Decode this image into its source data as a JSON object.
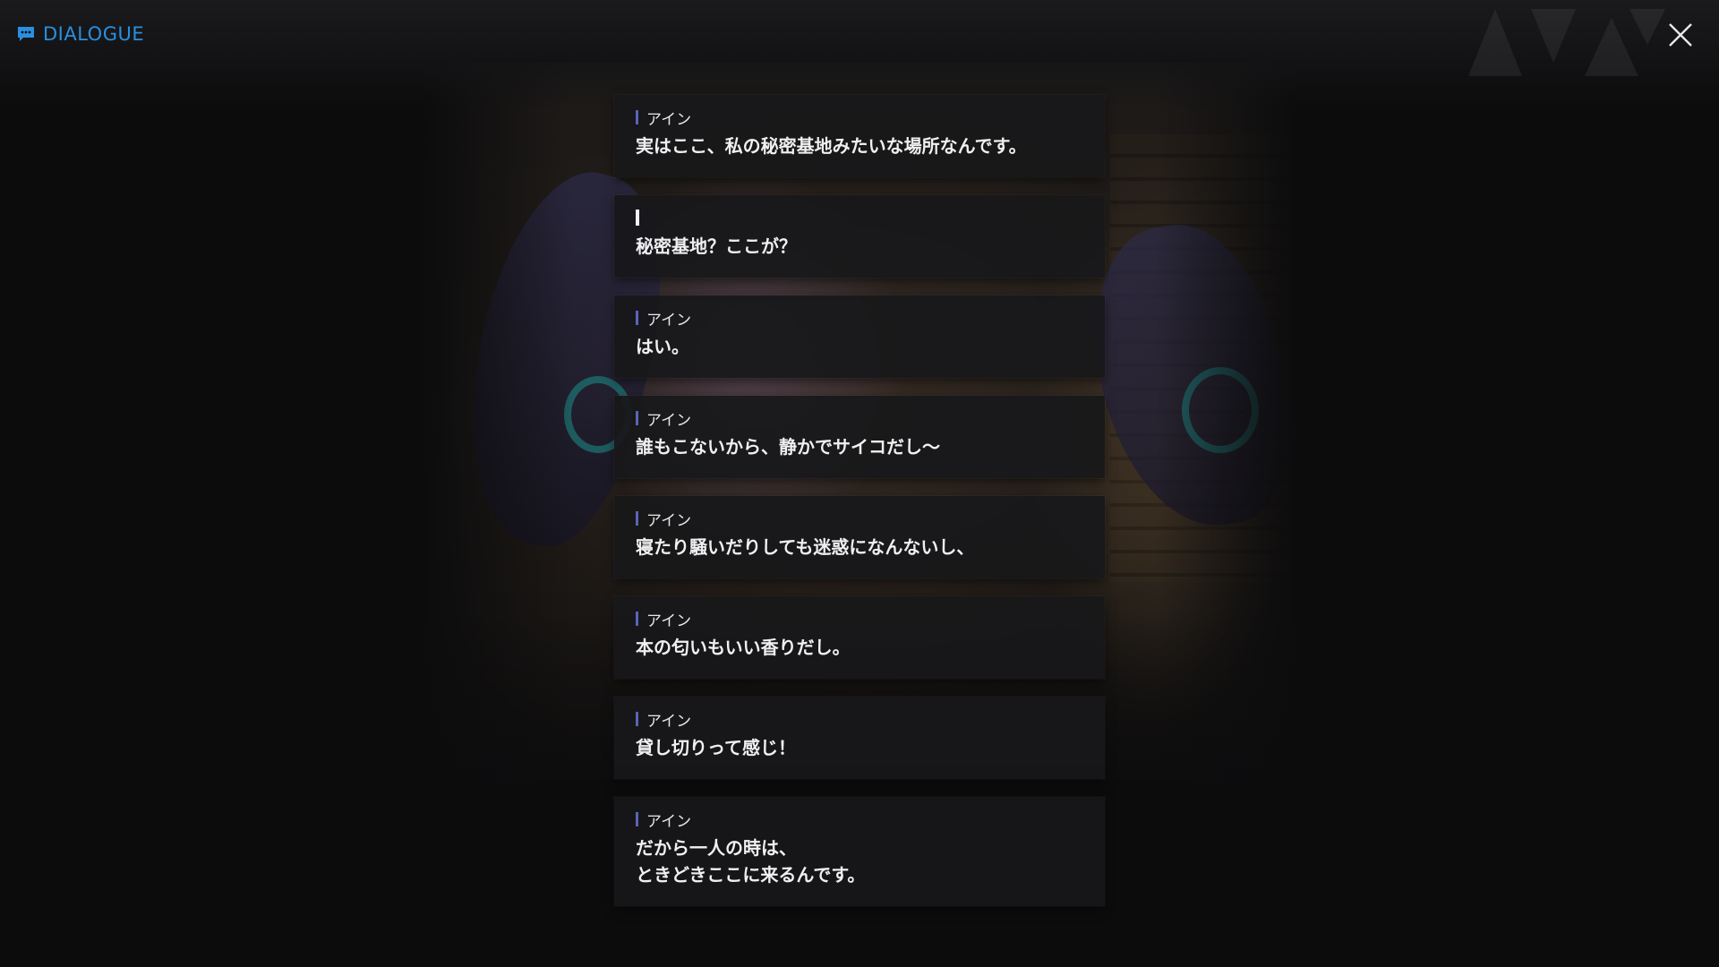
{
  "header": {
    "title": "DIALOGUE",
    "title_icon": "chat-bubble-icon",
    "accent_color": "#2a8fe0",
    "close_icon": "close-icon"
  },
  "dialogue": [
    {
      "speaker": "アイン",
      "lines": [
        "実はここ、私の秘密基地みたいな場所なんです。"
      ]
    },
    {
      "speaker": "",
      "lines": [
        "秘密基地？ここが？"
      ]
    },
    {
      "speaker": "アイン",
      "lines": [
        "はい。"
      ]
    },
    {
      "speaker": "アイン",
      "lines": [
        "誰もこないから、静かでサイコだし～"
      ]
    },
    {
      "speaker": "アイン",
      "lines": [
        "寝たり騒いだりしても迷惑になんないし、"
      ]
    },
    {
      "speaker": "アイン",
      "lines": [
        "本の匂いもいい香りだし。"
      ]
    },
    {
      "speaker": "アイン",
      "lines": [
        "貸し切りって感じ！"
      ]
    },
    {
      "speaker": "アイン",
      "lines": [
        "だから一人の時は、",
        "ときどきここに来るんです。"
      ]
    }
  ],
  "colors": {
    "speaker_bar": "#5b63b8",
    "player_bar": "#f2f2f2",
    "panel_bg": "#18181a"
  }
}
